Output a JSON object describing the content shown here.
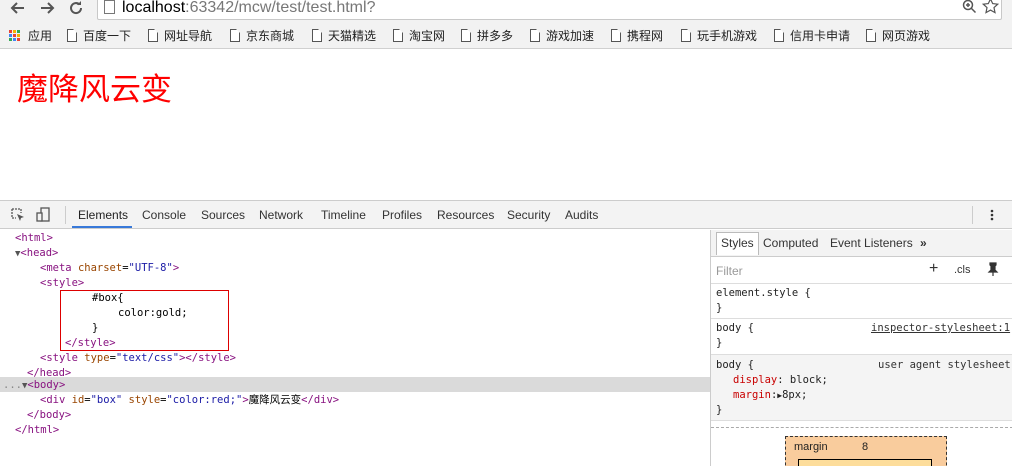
{
  "browser": {
    "back_icon": "back-arrow-icon",
    "forward_icon": "forward-arrow-icon",
    "reload_icon": "reload-icon",
    "url_host": "localhost",
    "url_rest": ":63342/mcw/test/test.html?",
    "zoom_icon": "zoom-icon",
    "star_icon": "star-icon"
  },
  "bookmarks": [
    {
      "label": "应用"
    },
    {
      "label": "百度一下"
    },
    {
      "label": "网址导航"
    },
    {
      "label": "京东商城"
    },
    {
      "label": "天猫精选"
    },
    {
      "label": "淘宝网"
    },
    {
      "label": "拼多多"
    },
    {
      "label": "游戏加速"
    },
    {
      "label": "携程网"
    },
    {
      "label": "玩手机游戏"
    },
    {
      "label": "信用卡申请"
    },
    {
      "label": "网页游戏"
    }
  ],
  "page": {
    "text": "魔降风云变",
    "color": "#ff0000"
  },
  "devtools": {
    "tabs": [
      "Elements",
      "Console",
      "Sources",
      "Network",
      "Timeline",
      "Profiles",
      "Resources",
      "Security",
      "Audits"
    ],
    "active_tab": "Elements",
    "dom": {
      "html_open": "<html>",
      "head_open": "<head>",
      "meta_tag": "meta",
      "meta_attr": "charset",
      "meta_val": "\"UTF-8\"",
      "style_open": "<style>",
      "css_selector": "#box{",
      "css_decl": "color:gold;",
      "css_close": "}",
      "style_close": "</style>",
      "style2_tag": "style",
      "style2_attr": "type",
      "style2_val": "\"text/css\"",
      "style2_close": "></style>",
      "head_close": "</head>",
      "body_open": "<body>",
      "div_tag": "div",
      "div_id_attr": "id",
      "div_id_val": "\"box\"",
      "div_style_attr": "style",
      "div_style_val": "\"color:red;\"",
      "div_text": "魔降风云变",
      "div_close": "</div>",
      "body_close": "</body>",
      "html_close": "</html>",
      "selected_marker": "..."
    },
    "styles": {
      "tabs": [
        "Styles",
        "Computed",
        "Event Listeners"
      ],
      "more": "»",
      "filter_placeholder": "Filter",
      "add": "+",
      "cls": ".cls",
      "rule1_selector": "element.style {",
      "rule1_close": "}",
      "rule2_selector": "body {",
      "rule2_source": "inspector-stylesheet:1",
      "rule2_close": "}",
      "rule3_selector": "body {",
      "rule3_source": "user agent stylesheet",
      "rule3_prop1": "display",
      "rule3_val1": "block;",
      "rule3_prop2": "margin",
      "rule3_val2": "8px;",
      "rule3_close": "}",
      "box_margin_label": "margin",
      "box_margin_value": "8"
    }
  }
}
